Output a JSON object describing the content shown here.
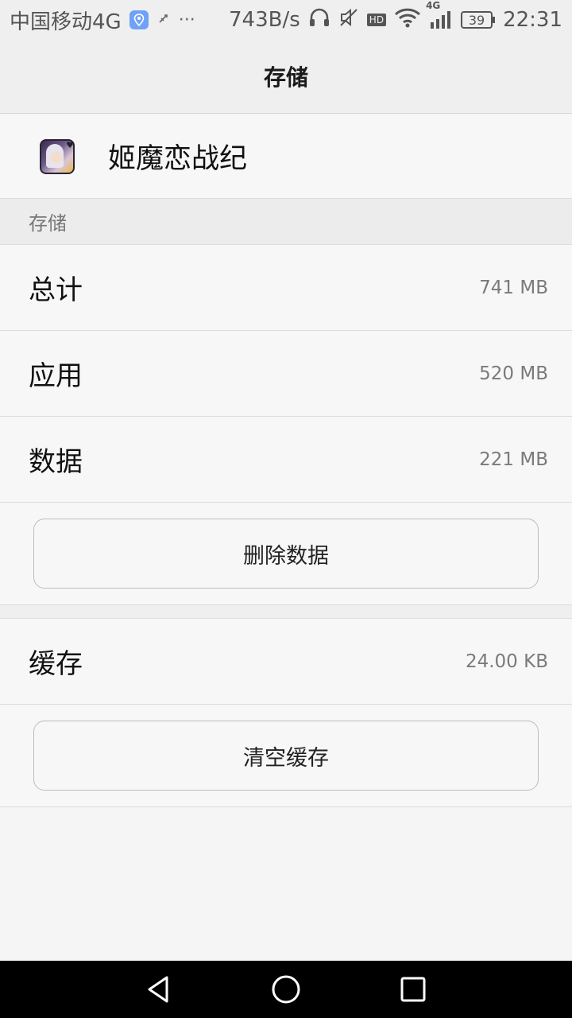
{
  "status_bar": {
    "carrier": "中国移动4G",
    "speed": "743B/s",
    "network_type": "4G",
    "hd_label": "HD",
    "battery": "39",
    "time": "22:31",
    "icons": [
      "location-pin-icon",
      "usb-debug-icon",
      "more-dots-icon",
      "headphones-icon",
      "vibrate-off-icon",
      "hd-icon",
      "wifi-icon",
      "signal-icon",
      "battery-icon"
    ]
  },
  "title_bar": {
    "title": "存储"
  },
  "app": {
    "name": "姬魔恋战纪"
  },
  "section": {
    "header": "存储"
  },
  "rows": {
    "total": {
      "label": "总计",
      "value": "741 MB"
    },
    "app": {
      "label": "应用",
      "value": "520 MB"
    },
    "data": {
      "label": "数据",
      "value": "221 MB"
    },
    "cache": {
      "label": "缓存",
      "value": "24.00 KB"
    }
  },
  "buttons": {
    "delete_data": "删除数据",
    "clear_cache": "清空缓存"
  },
  "nav": {
    "icons": [
      "back-icon",
      "home-icon",
      "recents-icon"
    ]
  },
  "colors": {
    "background": "#f5f5f5",
    "navbar": "#000000",
    "pin_badge": "#6fa2f7"
  }
}
